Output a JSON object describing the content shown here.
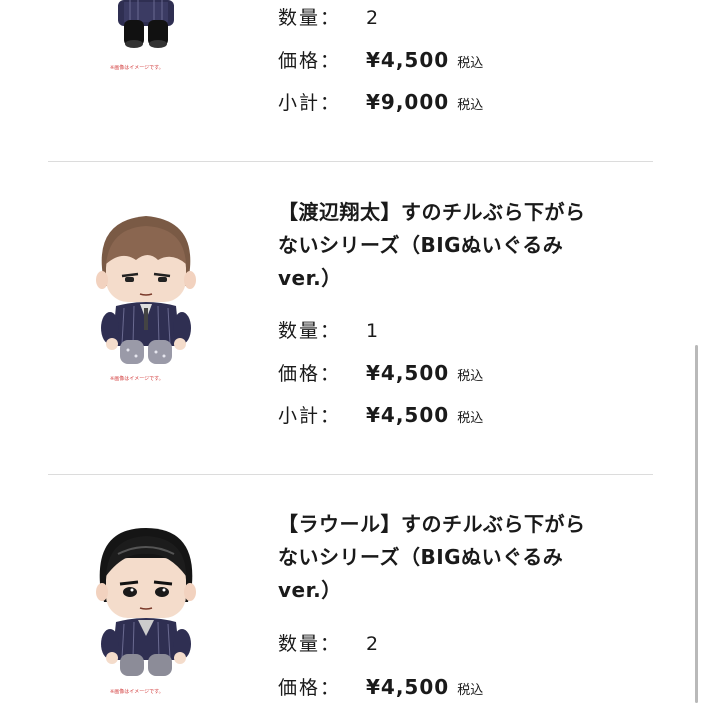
{
  "labels": {
    "quantity": "数量：",
    "price": "価格：",
    "subtotal": "小計：",
    "tax": "税込"
  },
  "items": [
    {
      "caption": "※画像はイメージです。",
      "quantity": "2",
      "price": "¥4,500",
      "subtotal": "¥9,000"
    },
    {
      "title_lines": [
        "【渡辺翔太】すのチルぶら下がら",
        "ないシリーズ（BIGぬいぐるみ",
        "ver.）"
      ],
      "caption": "※画像はイメージです。",
      "quantity": "1",
      "price": "¥4,500",
      "subtotal": "¥4,500"
    },
    {
      "title_lines": [
        "【ラウール】すのチルぶら下がら",
        "ないシリーズ（BIGぬいぐるみ",
        "ver.）"
      ],
      "caption": "※画像はイメージです。",
      "quantity": "2",
      "price": "¥4,500"
    }
  ],
  "colors": {
    "divider": "#dcdcdc",
    "caption_red": "#d23a3a",
    "suit": "#2f2f52"
  }
}
